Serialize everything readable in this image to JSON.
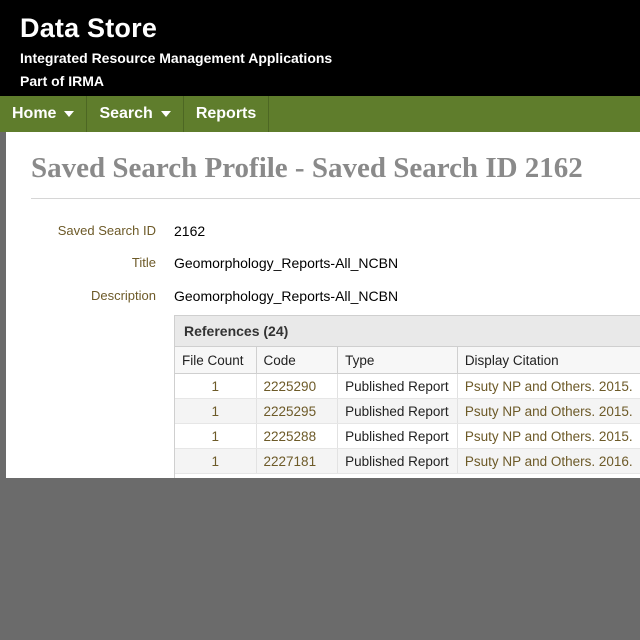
{
  "header": {
    "title": "Data Store",
    "subtitle": "Integrated Resource Management Applications",
    "parent": "Part of IRMA"
  },
  "nav": {
    "home": "Home",
    "search": "Search",
    "reports": "Reports"
  },
  "page": {
    "title": "Saved Search Profile - Saved Search ID 2162"
  },
  "fields": {
    "id_label": "Saved Search ID",
    "id_value": "2162",
    "title_label": "Title",
    "title_value": "Geomorphology_Reports-All_NCBN",
    "desc_label": "Description",
    "desc_value": "Geomorphology_Reports-All_NCBN"
  },
  "references": {
    "header": "References (24)",
    "columns": [
      "File Count",
      "Code",
      "Type",
      "Display Citation"
    ],
    "rows": [
      {
        "count": "1",
        "code": "2225290",
        "type": "Published Report",
        "citation": "Psuty NP and Others. 2015."
      },
      {
        "count": "1",
        "code": "2225295",
        "type": "Published Report",
        "citation": "Psuty NP and Others. 2015."
      },
      {
        "count": "1",
        "code": "2225288",
        "type": "Published Report",
        "citation": "Psuty NP and Others. 2015."
      },
      {
        "count": "1",
        "code": "2227181",
        "type": "Published Report",
        "citation": "Psuty NP and Others. 2016."
      }
    ]
  }
}
